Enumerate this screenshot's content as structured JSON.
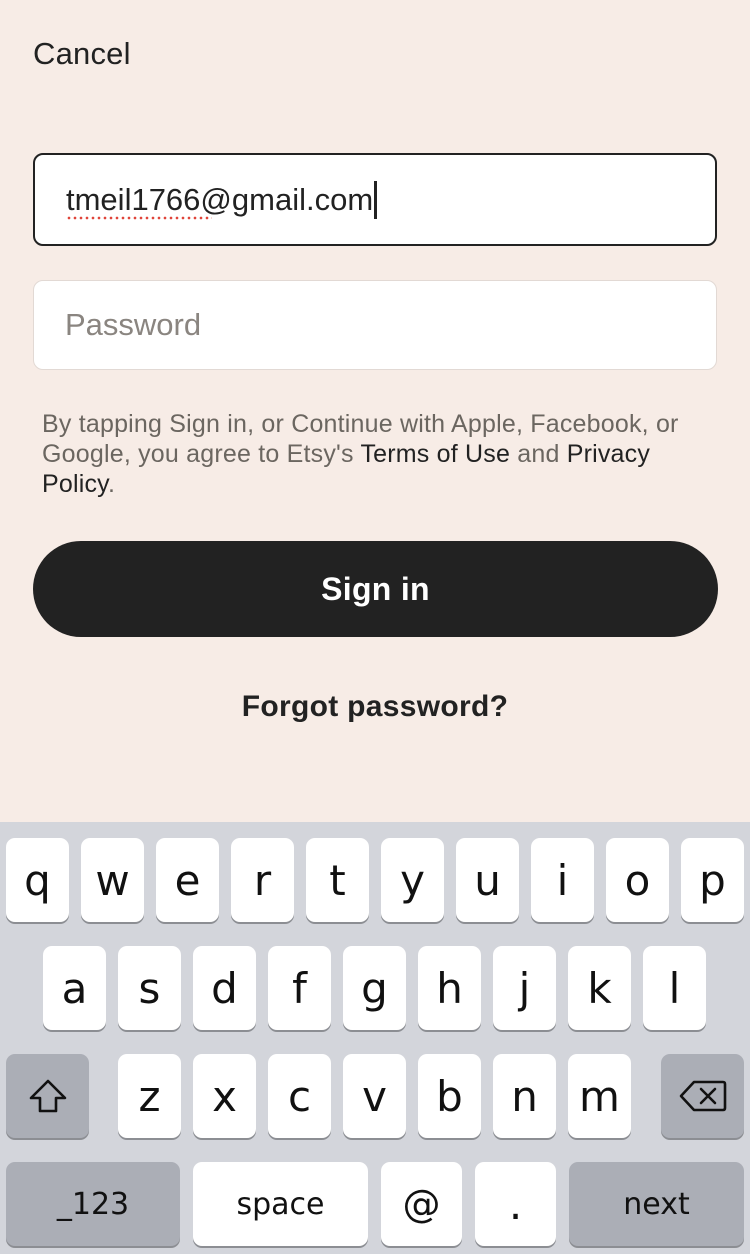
{
  "header": {
    "cancel_label": "Cancel"
  },
  "form": {
    "email_value": "tmeil1766@gmail.com",
    "password_placeholder": "Password"
  },
  "legal": {
    "prefix": "By tapping Sign in, or Continue with Apple, Facebook, or Google, you agree to Etsy's ",
    "terms_link": "Terms of Use",
    "and_text": " and ",
    "privacy_link": "Privacy Policy",
    "suffix": "."
  },
  "actions": {
    "signin_label": "Sign in",
    "forgot_label": "Forgot password?"
  },
  "keyboard": {
    "row1": [
      "q",
      "w",
      "e",
      "r",
      "t",
      "y",
      "u",
      "i",
      "o",
      "p"
    ],
    "row2": [
      "a",
      "s",
      "d",
      "f",
      "g",
      "h",
      "j",
      "k",
      "l"
    ],
    "row3": [
      "z",
      "x",
      "c",
      "v",
      "b",
      "n",
      "m"
    ],
    "shift_icon": "shift-icon",
    "backspace_icon": "backspace-icon",
    "numbers_label": "_123",
    "space_label": "space",
    "at_label": "@",
    "period_label": ".",
    "next_label": "next"
  },
  "colors": {
    "background": "#f7ece6",
    "primary_button": "#222222",
    "keyboard_background": "#d3d5db",
    "spellcheck_underline": "#e0443a"
  }
}
